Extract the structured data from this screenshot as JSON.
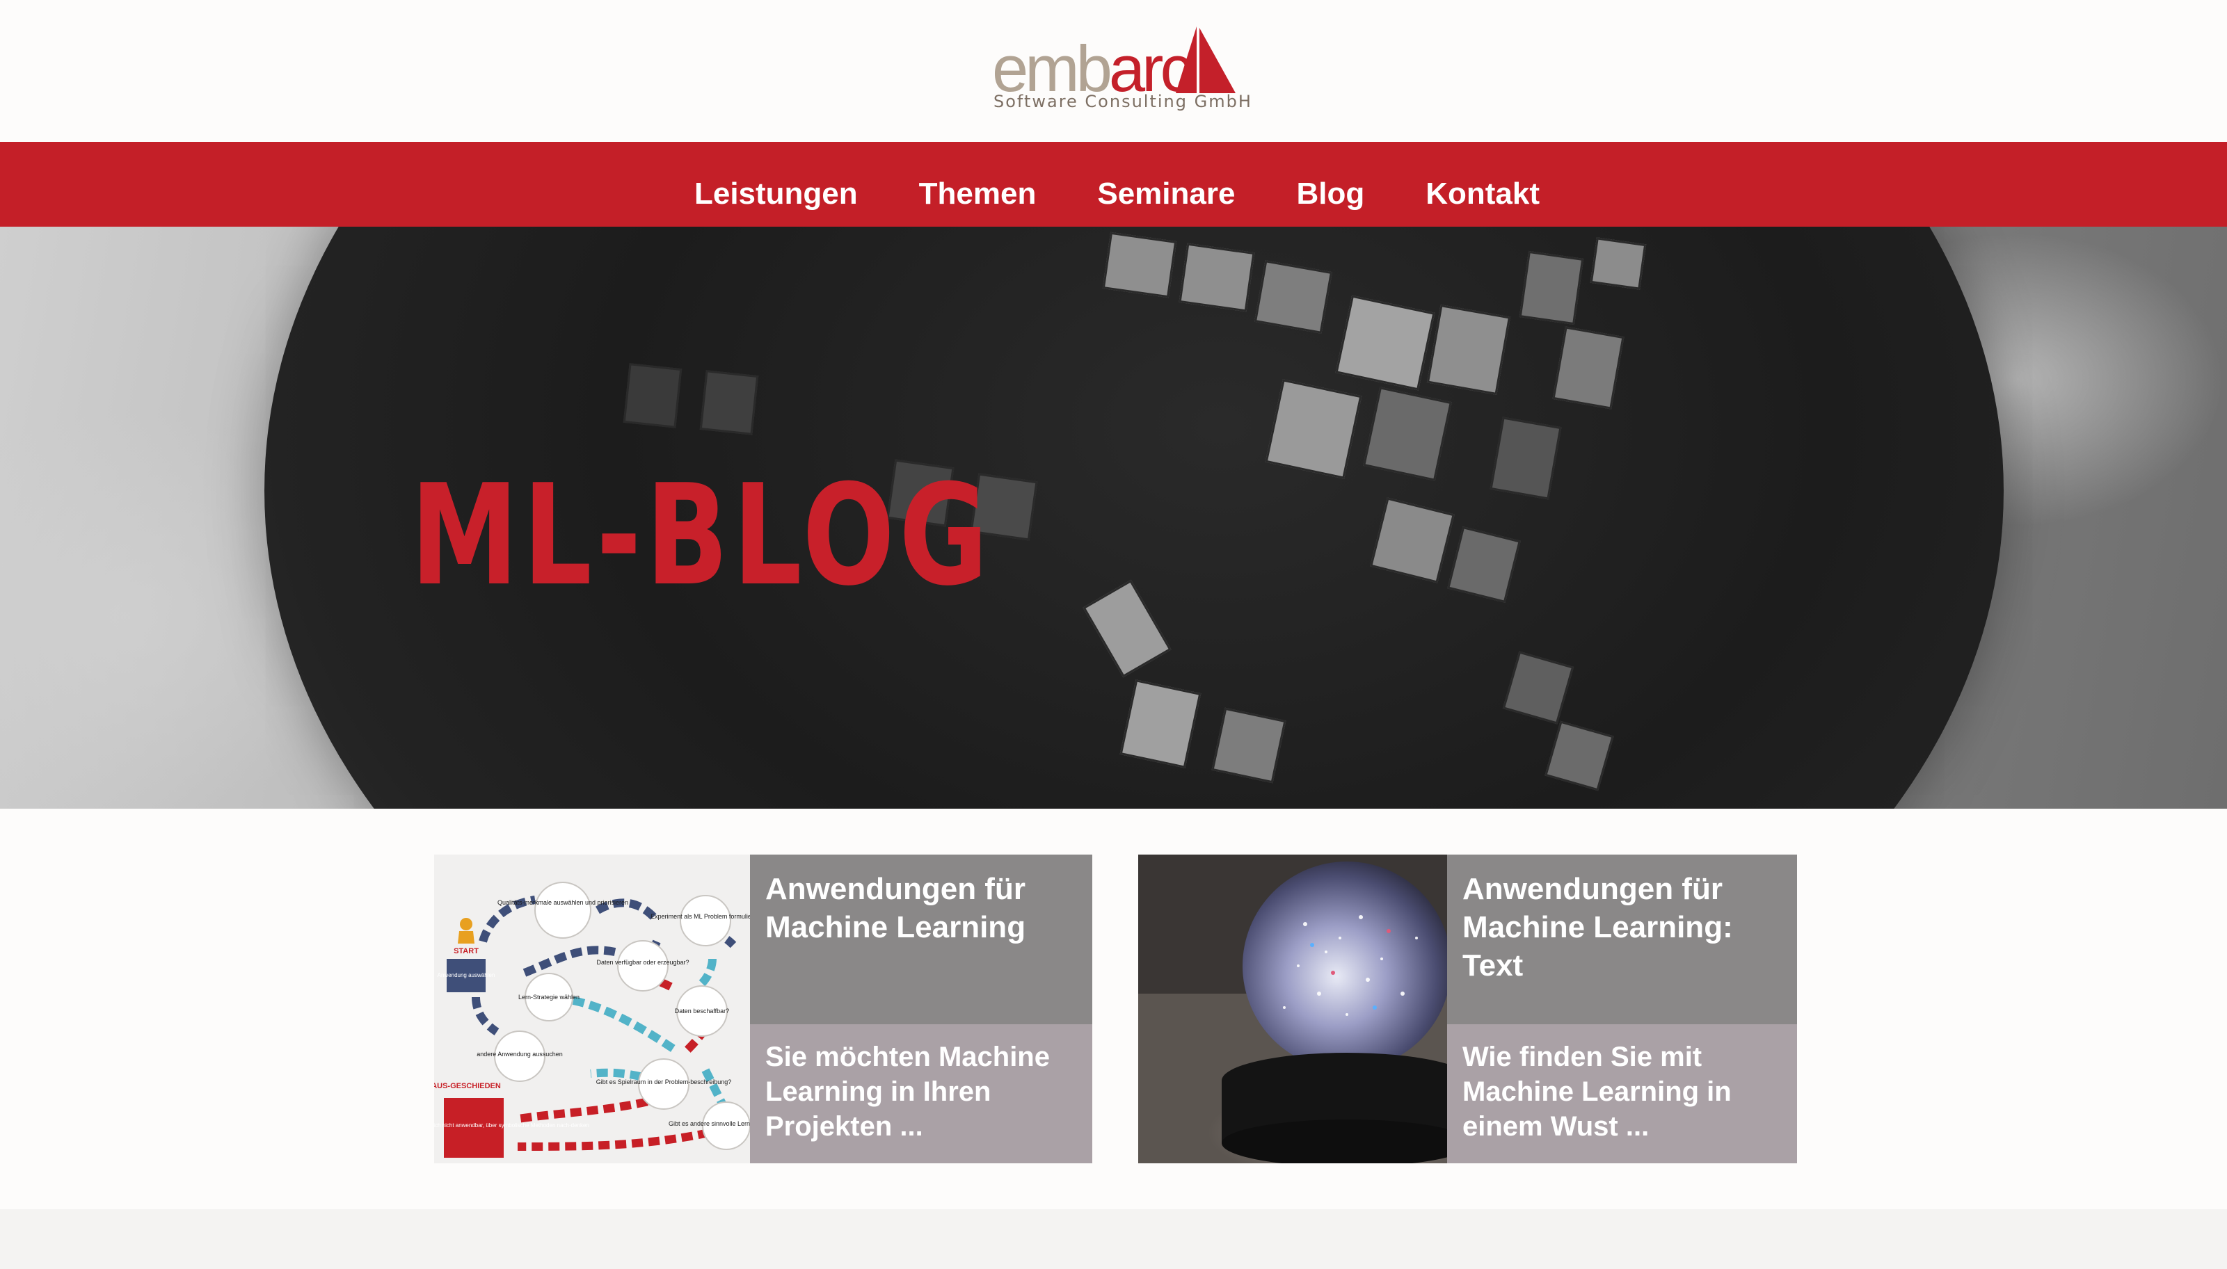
{
  "logo": {
    "word_part1": "emb",
    "word_part2": "arc",
    "tagline": "Software Consulting GmbH",
    "colors": {
      "primary": "#c4202a",
      "secondary": "#b1a393"
    }
  },
  "nav": {
    "items": [
      {
        "label": "Leistungen"
      },
      {
        "label": "Themen"
      },
      {
        "label": "Seminare"
      },
      {
        "label": "Blog"
      },
      {
        "label": "Kontakt"
      }
    ]
  },
  "hero": {
    "title": "ML-BLOG"
  },
  "posts": [
    {
      "title": "Anwendungen für Machine Learning",
      "excerpt": "Sie möchten Machine Learning in Ihren Projekten ...",
      "image_icon": "flowchart-diagram",
      "diagram": {
        "start": "START",
        "start_box": "Anwendung auswählen",
        "out_label": "AUS-GESCHIEDEN",
        "out_box": "Machine Learning wahrscheinlich nicht anwendbar, über symbolische Methoden nach-denken",
        "nodes": [
          "Qualitäts-merkmale auswählen und priorisieren",
          "Experiment als ML Problem formulieren",
          "Daten verfügbar oder erzeugbar?",
          "Lern-Strategie wählen",
          "Daten beschaffbar?",
          "andere Anwendung aussuchen",
          "Gibt es Spielraum in der Problem-beschreibung?",
          "Gibt es andere sinnvolle Lern-Strategien?"
        ]
      }
    },
    {
      "title": "Anwendungen für Machine Learning: Text",
      "excerpt": "Wie finden Sie mit Machine Learning in einem Wust ...",
      "image_icon": "snow-globe-photo"
    }
  ],
  "colors": {
    "nav_bg": "#c41f28",
    "card_title_bg": "#8a8888",
    "card_excerpt_bg": "#aaa1a6",
    "hero_title": "#c8202a",
    "footer_bg": "#f4f3f2"
  }
}
